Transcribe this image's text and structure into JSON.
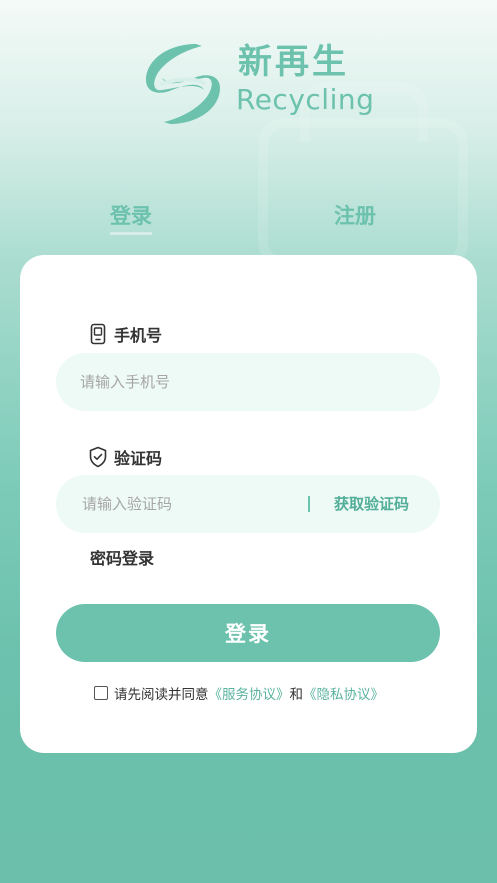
{
  "brand": {
    "name_cn": "新再生",
    "name_en": "Recycling"
  },
  "tabs": {
    "login": "登录",
    "register": "注册"
  },
  "form": {
    "phone": {
      "label": "手机号",
      "placeholder": "请输入手机号",
      "icon": "phone-icon"
    },
    "code": {
      "label": "验证码",
      "placeholder": "请输入验证码",
      "icon": "shield-check-icon",
      "get_code": "获取验证码"
    },
    "password_login": "密码登录",
    "submit": "登录",
    "agreement": {
      "prefix": "请先阅读并同意",
      "service": "《服务协议》",
      "and": "和",
      "privacy": "《隐私协议》"
    }
  },
  "colors": {
    "accent": "#6cc2ad",
    "input_bg": "#eefaf6"
  }
}
